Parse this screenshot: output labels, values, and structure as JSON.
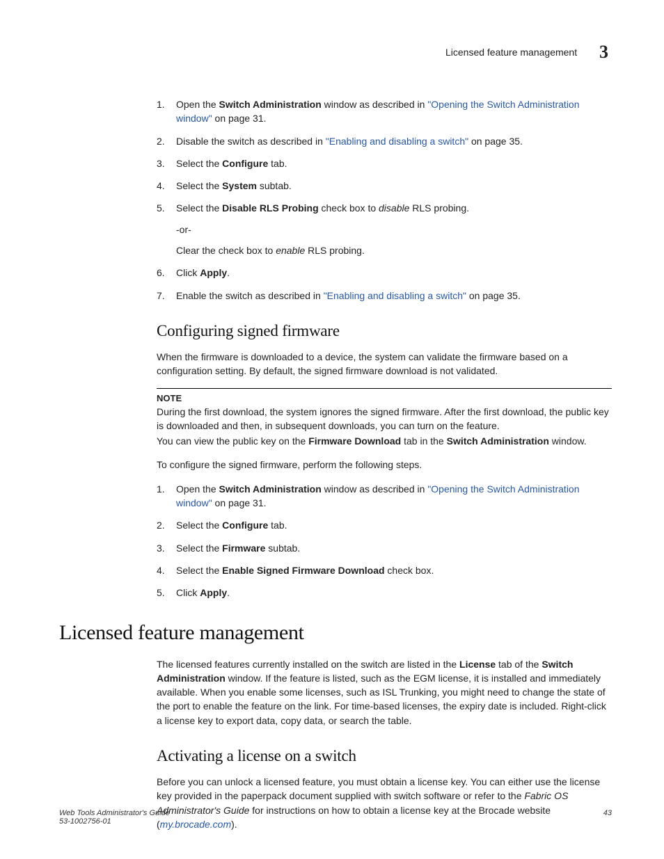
{
  "header": {
    "title": "Licensed feature management",
    "chapter_number": "3"
  },
  "ol1": {
    "i1": {
      "pre": "Open the ",
      "b1": "Switch Administration",
      "mid": " window as described in ",
      "link": "\"Opening the Switch Administration window\"",
      "post": " on page 31."
    },
    "i2": {
      "pre": "Disable the switch as described in ",
      "link": "\"Enabling and disabling a switch\"",
      "post": " on page 35."
    },
    "i3": {
      "pre": "Select the ",
      "b1": "Configure",
      "post": " tab."
    },
    "i4": {
      "pre": "Select the ",
      "b1": "System",
      "post": " subtab."
    },
    "i5": {
      "pre": "Select the ",
      "b1": "Disable RLS Probing",
      "mid": " check box to ",
      "it": "disable",
      "post": " RLS probing.",
      "or": "-or-",
      "clr_pre": "Clear the check box to ",
      "clr_it": "enable",
      "clr_post": " RLS probing."
    },
    "i6": {
      "pre": "Click ",
      "b1": "Apply",
      "post": "."
    },
    "i7": {
      "pre": "Enable the switch as described in ",
      "link": "\"Enabling and disabling a switch\"",
      "post": " on page 35."
    }
  },
  "sec1": {
    "heading": "Configuring signed firmware",
    "p1": "When the firmware is downloaded to a device, the system can validate the firmware based on a configuration setting. By default, the signed firmware download is not validated.",
    "note_head": "NOTE",
    "note_l1": "During the first download, the system ignores the signed firmware. After the first download, the public key is downloaded and then, in subsequent downloads, you can turn on the feature.",
    "note_l2a": "You can view the public key on the ",
    "note_l2b": "Firmware Download",
    "note_l2c": " tab in the ",
    "note_l2d": "Switch Administration",
    "note_l2e": " window.",
    "p2": "To configure the signed firmware, perform the following steps."
  },
  "ol2": {
    "i1": {
      "pre": "Open the ",
      "b1": "Switch Administration",
      "mid": " window as described in ",
      "link": "\"Opening the Switch Administration window\"",
      "post": " on page 31."
    },
    "i2": {
      "pre": "Select the ",
      "b1": "Configure",
      "post": " tab."
    },
    "i3": {
      "pre": "Select the ",
      "b1": "Firmware",
      "post": " subtab."
    },
    "i4": {
      "pre": "Select the ",
      "b1": "Enable Signed Firmware Download",
      "post": " check box."
    },
    "i5": {
      "pre": "Click ",
      "b1": "Apply",
      "post": "."
    }
  },
  "sec2": {
    "heading": "Licensed feature management",
    "p1a": "The licensed features currently installed on the switch are listed in the ",
    "p1b": "License",
    "p1c": " tab of the ",
    "p1d": "Switch Administration",
    "p1e": " window. If the feature is listed, such as the EGM license, it is installed and immediately available. When you enable some licenses, such as ISL Trunking, you might need to change the state of the port to enable the feature on the link. For time-based licenses, the expiry date is included. Right-click a license key to export data, copy data, or search the table."
  },
  "sec3": {
    "heading": "Activating a license on a switch",
    "p1a": "Before you can unlock a licensed feature, you must obtain a license key. You can either use the license key provided in the paperpack document supplied with switch software or refer to the ",
    "p1b": "Fabric OS Administrator's Guide",
    "p1c": " for instructions on how to obtain a license key at the Brocade website (",
    "p1d": "my.brocade.com",
    "p1e": ")."
  },
  "footer": {
    "book": "Web Tools Administrator's Guide",
    "docnum": "53-1002756-01",
    "page": "43"
  }
}
